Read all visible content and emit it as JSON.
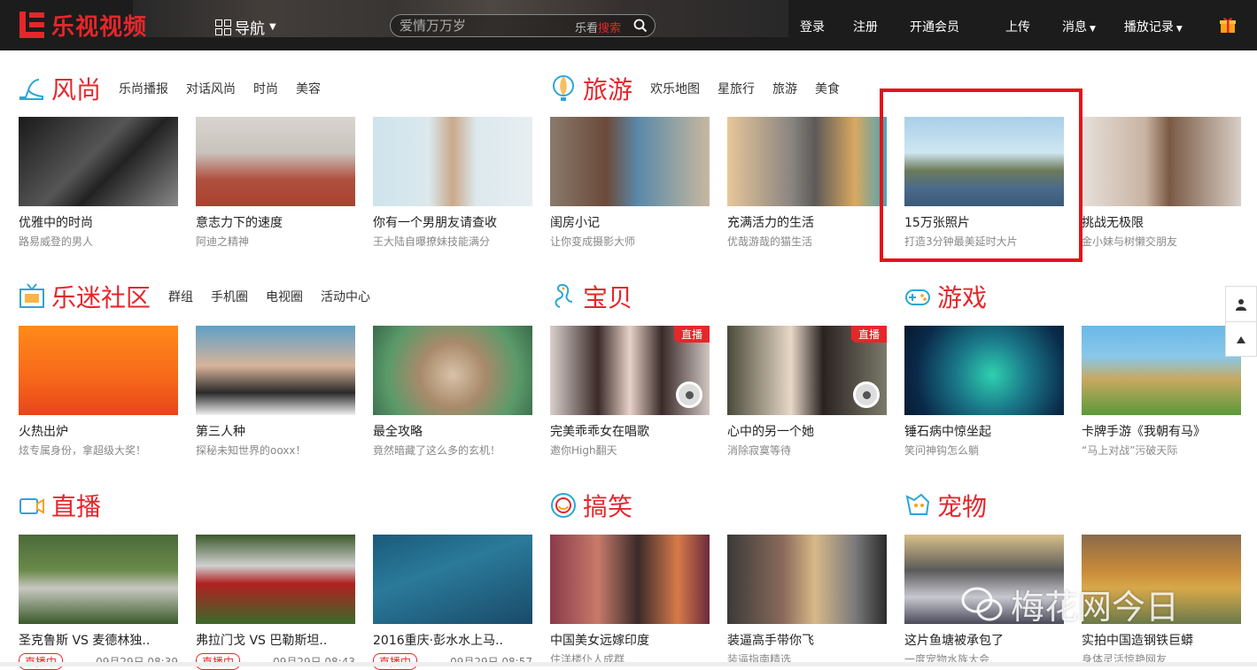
{
  "header": {
    "logo_text": "乐视视频",
    "nav_label": "导航",
    "search_placeholder": "爱情万万岁",
    "search_brand_a": "乐看",
    "search_brand_b": "搜索",
    "links": {
      "login": "登录",
      "register": "注册",
      "vip": "开通会员",
      "upload": "上传",
      "messages": "消息",
      "history": "播放记录"
    }
  },
  "sections": {
    "fashion": {
      "title": "风尚",
      "subs": [
        "乐尚播报",
        "对话风尚",
        "时尚",
        "美容"
      ],
      "cards": [
        {
          "title": "优雅中的时尚",
          "desc": "路易威登的男人"
        },
        {
          "title": "意志力下的速度",
          "desc": "阿迪之精神"
        },
        {
          "title": "你有一个男朋友请查收",
          "desc": "王大陆自曝撩妹技能满分"
        }
      ]
    },
    "travel": {
      "title": "旅游",
      "subs": [
        "欢乐地图",
        "星旅行",
        "旅游",
        "美食"
      ],
      "cards": [
        {
          "title": "闺房小记",
          "desc": "让你变成摄影大师"
        },
        {
          "title": "充满活力的生活",
          "desc": "优哉游哉的猫生活"
        },
        {
          "title": "15万张照片",
          "desc": "打造3分钟最美延时大片"
        },
        {
          "title": "挑战无极限",
          "desc": "金小妹与树懒交朋友"
        }
      ]
    },
    "community": {
      "title": "乐迷社区",
      "subs": [
        "群组",
        "手机圈",
        "电视圈",
        "活动中心"
      ],
      "cards": [
        {
          "title": "火热出炉",
          "desc": "炫专属身份，拿超级大奖！"
        },
        {
          "title": "第三人种",
          "desc": "探秘未知世界的ooxx！"
        },
        {
          "title": "最全攻略",
          "desc": "竟然暗藏了这么多的玄机！"
        }
      ]
    },
    "baby": {
      "title": "宝贝",
      "cards": [
        {
          "title": "完美乖乖女在唱歌",
          "desc": "邀你High翻天",
          "tag": "直播"
        },
        {
          "title": "心中的另一个她",
          "desc": "消除寂寞等待",
          "tag": "直播"
        }
      ]
    },
    "game": {
      "title": "游戏",
      "cards": [
        {
          "title": "锤石病中惊坐起",
          "desc": "笑问神钩怎么躺"
        },
        {
          "title": "卡牌手游《我朝有马》",
          "desc": "“马上对战”污破天际"
        }
      ]
    },
    "live": {
      "title": "直播",
      "cards": [
        {
          "title": "圣克鲁斯 VS 麦德林独..",
          "badge": "直播中",
          "time": "09月29日 08:39"
        },
        {
          "title": "弗拉门戈 VS 巴勒斯坦..",
          "badge": "直播中",
          "time": "09月29日 08:43"
        },
        {
          "title": "2016重庆·彭水水上马..",
          "badge": "直播中",
          "time": "09月29日 08:57"
        }
      ]
    },
    "funny": {
      "title": "搞笑",
      "cards": [
        {
          "title": "中国美女远嫁印度",
          "desc": "住洋楼仆人成群"
        },
        {
          "title": "装逼高手带你飞",
          "desc": "装逼指南精选"
        }
      ]
    },
    "pets": {
      "title": "宠物",
      "cards": [
        {
          "title": "这片鱼塘被承包了",
          "desc": "一度宠物水族大会"
        },
        {
          "title": "实拍中国造钢铁巨蟒",
          "desc": "身体灵活惊艳网友"
        }
      ]
    }
  },
  "watermark": "梅花网今日"
}
